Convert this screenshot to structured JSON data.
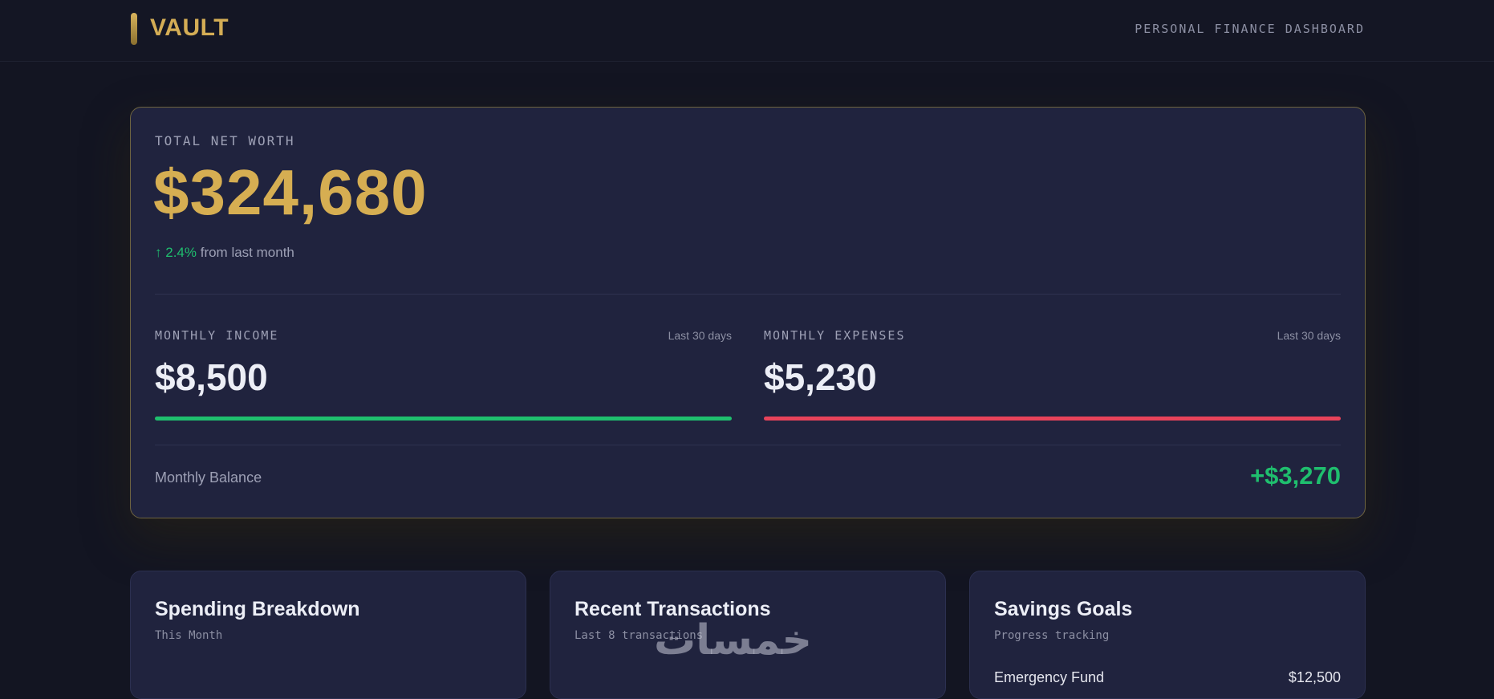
{
  "header": {
    "logo_text": "VAULT",
    "subtitle": "PERSONAL FINANCE DASHBOARD"
  },
  "net_worth": {
    "label": "TOTAL NET WORTH",
    "value": "$324,680",
    "change_arrow": "↑",
    "change_value": "2.4%",
    "change_text": "from last month"
  },
  "income": {
    "label": "MONTHLY INCOME",
    "period": "Last 30 days",
    "value": "$8,500",
    "bar_color": "#1fbf6e",
    "bar_fill": 1.0
  },
  "expenses": {
    "label": "MONTHLY EXPENSES",
    "period": "Last 30 days",
    "value": "$5,230",
    "bar_color": "#e8435a",
    "bar_fill": 1.0
  },
  "balance": {
    "label": "Monthly Balance",
    "value": "+$3,270"
  },
  "cards": {
    "spending": {
      "title": "Spending Breakdown",
      "subtitle": "This Month"
    },
    "transactions": {
      "title": "Recent Transactions",
      "subtitle": "Last 8 transactions"
    },
    "savings": {
      "title": "Savings Goals",
      "subtitle": "Progress tracking",
      "goals": [
        {
          "name": "Emergency Fund",
          "amount": "$12,500"
        }
      ]
    }
  },
  "watermark": "خمسات",
  "colors": {
    "accent_gold": "#d6ae52",
    "positive": "#1fbf6e",
    "negative": "#e8435a",
    "card_bg": "#20233e",
    "page_bg": "#131522"
  }
}
